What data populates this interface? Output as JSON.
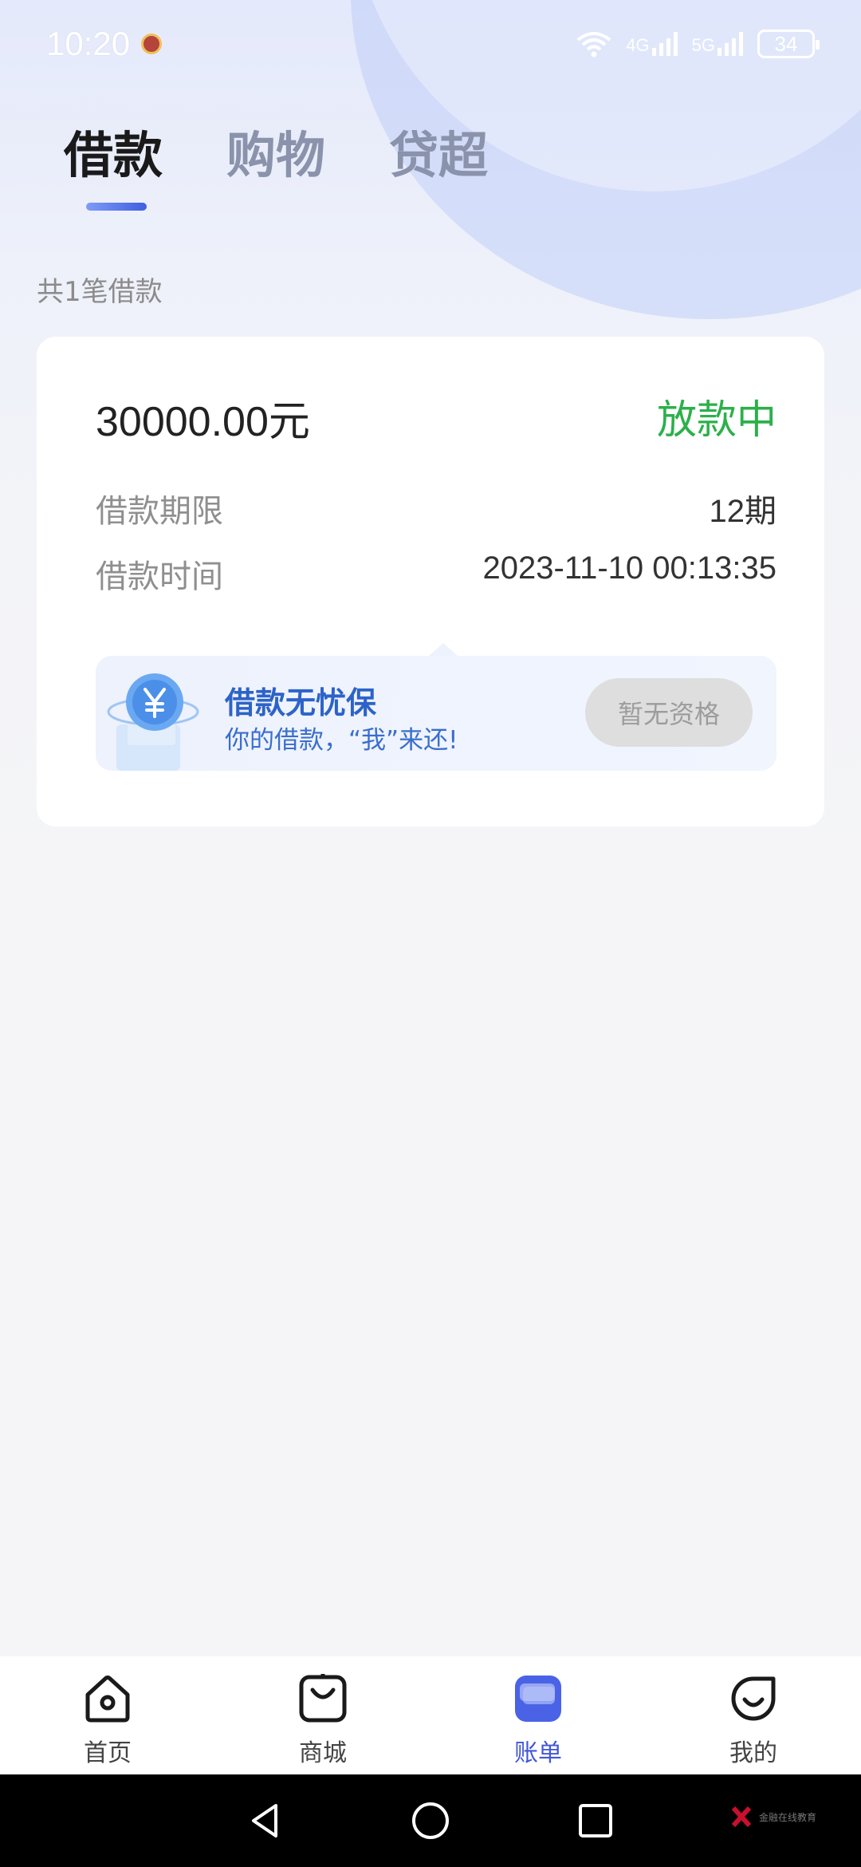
{
  "status_bar": {
    "time": "10:20",
    "signal_1": "4G",
    "signal_2": "5G",
    "battery": "34"
  },
  "tabs": [
    {
      "label": "借款",
      "active": true
    },
    {
      "label": "购物",
      "active": false
    },
    {
      "label": "贷超",
      "active": false
    }
  ],
  "summary": {
    "count_text": "共1笔借款"
  },
  "loan_card": {
    "amount": "30000.00元",
    "status": "放款中",
    "status_color": "#2cb04a",
    "term_label": "借款期限",
    "term_value": "12期",
    "time_label": "借款时间",
    "time_value": "2023-11-10 00:13:35",
    "insurance": {
      "title": "借款无忧保",
      "subtitle": "你的借款，“我”来还!",
      "button": "暂无资格",
      "icon": "yen-coin-icon"
    }
  },
  "bottom_nav": [
    {
      "label": "首页",
      "icon": "home-icon",
      "active": false
    },
    {
      "label": "商城",
      "icon": "shop-bag-icon",
      "active": false
    },
    {
      "label": "账单",
      "icon": "bill-icon",
      "active": true
    },
    {
      "label": "我的",
      "icon": "profile-icon",
      "active": false
    }
  ],
  "watermark": {
    "text": "金融在线教育"
  },
  "colors": {
    "accent": "#4157d8",
    "tab_active": "#1a1a1a",
    "tab_inactive": "#8a93ab",
    "insurance_text": "#2d63c8"
  }
}
